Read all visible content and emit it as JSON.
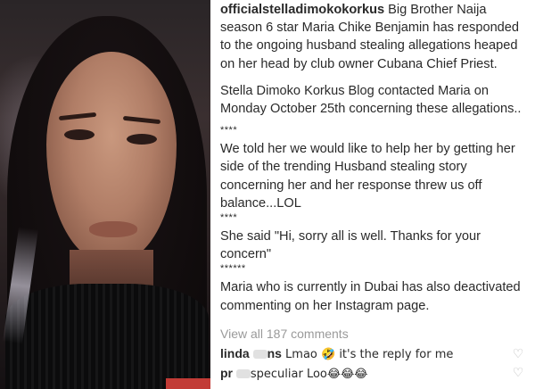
{
  "post": {
    "username": "officialstelladimokokorkus",
    "paragraphs": [
      " Big Brother Naija season 6 star Maria Chike Benjamin has responded to the ongoing husband stealing allegations heaped on her head by club owner Cubana Chief Priest.",
      "Stella Dimoko Korkus Blog contacted Maria on Monday October 25th concerning these allegations..",
      "We told her we would like to help her by getting her side of the trending Husband stealing story concerning her and her response threw us off balance...LOL",
      "She said \"Hi, sorry all is well. Thanks for your concern\"",
      "Maria who is currently in Dubai has also deactivated commenting on her Instagram page."
    ],
    "separators": [
      "****",
      "****",
      "******"
    ]
  },
  "comments": {
    "view_all": "View all 187 comments",
    "items": [
      {
        "user_start": "linda",
        "user_end": "ns",
        "text": " Lmao 🤣 it's the reply for me"
      },
      {
        "user_start": "pr",
        "user_end": "",
        "text": "speculiar Loo😂😂😂"
      }
    ]
  },
  "icons": {
    "like": "heart-outline-icon"
  },
  "colors": {
    "caption_text": "#2a2a2a",
    "muted": "#9a9a9a",
    "heart": "#b9b9b9"
  }
}
